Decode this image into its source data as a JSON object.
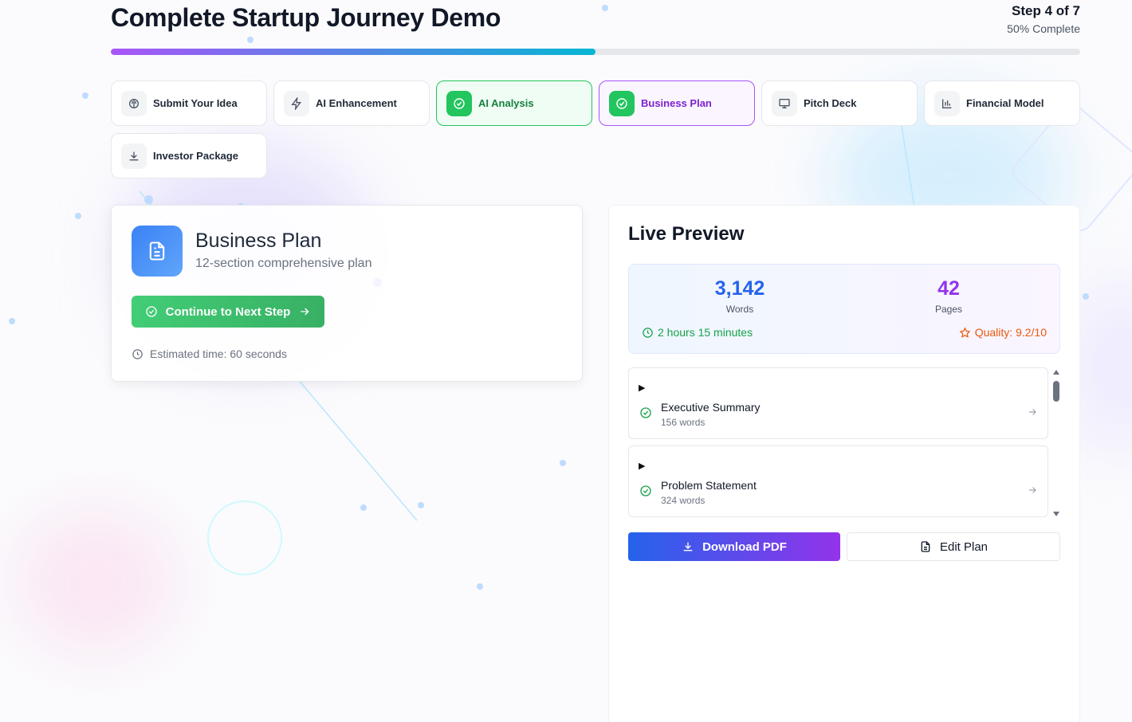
{
  "header": {
    "title": "Complete Startup Journey Demo",
    "step_label": "Step 4 of 7",
    "percent_label": "50% Complete",
    "progress": 0.5
  },
  "steps": [
    {
      "label": "Submit Your Idea",
      "icon": "brain-icon",
      "state": "default"
    },
    {
      "label": "AI Enhancement",
      "icon": "zap-icon",
      "state": "default"
    },
    {
      "label": "AI Analysis",
      "icon": "check-circle-icon",
      "state": "done"
    },
    {
      "label": "Business Plan",
      "icon": "check-circle-icon",
      "state": "active"
    },
    {
      "label": "Pitch Deck",
      "icon": "presentation-icon",
      "state": "default"
    },
    {
      "label": "Financial Model",
      "icon": "bar-chart-icon",
      "state": "default"
    },
    {
      "label": "Investor Package",
      "icon": "download-icon",
      "state": "default"
    }
  ],
  "current_step": {
    "title": "Business Plan",
    "subtitle": "12-section comprehensive plan",
    "continue_label": "Continue to Next Step",
    "estimate": "Estimated time: 60 seconds"
  },
  "preview": {
    "title": "Live Preview",
    "words_value": "3,142",
    "words_label": "Words",
    "pages_value": "42",
    "pages_label": "Pages",
    "read_time": "2 hours 15 minutes",
    "quality": "Quality: 9.2/10",
    "sections": [
      {
        "name": "Executive Summary",
        "words": "156 words"
      },
      {
        "name": "Problem Statement",
        "words": "324 words"
      }
    ],
    "download_label": "Download PDF",
    "edit_label": "Edit Plan"
  },
  "colors": {
    "accent_blue": "#2563eb",
    "accent_purple": "#9333ea",
    "success": "#22c55e",
    "warning": "#ea580c"
  }
}
